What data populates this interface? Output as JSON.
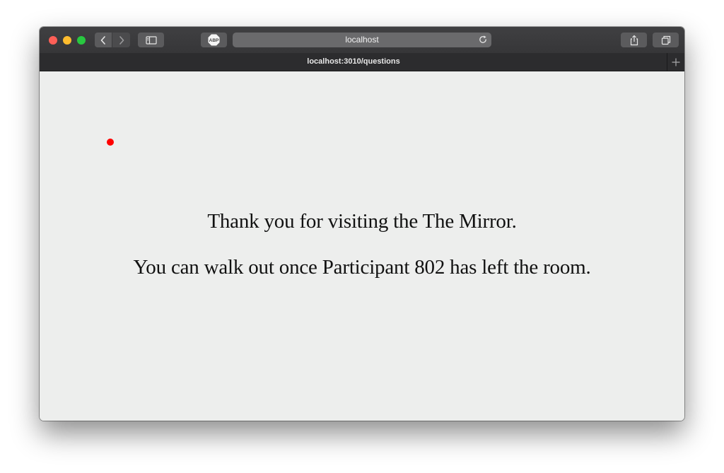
{
  "browser": {
    "address_text": "localhost",
    "tab_title": "localhost:3010/questions",
    "abp_label": "ABP"
  },
  "page": {
    "message_1": "Thank you for visiting the The Mirror.",
    "message_2": "You can walk out once Participant 802 has left the room.",
    "indicator_color": "#ff0000",
    "background_color": "#edeeed"
  },
  "icons": {
    "back": "chevron-left-icon",
    "forward": "chevron-right-icon",
    "sidebar": "sidebar-icon",
    "abp": "adblock-icon",
    "reload": "reload-icon",
    "share": "share-icon",
    "tabs": "tabs-overview-icon",
    "new_tab": "plus-icon"
  }
}
